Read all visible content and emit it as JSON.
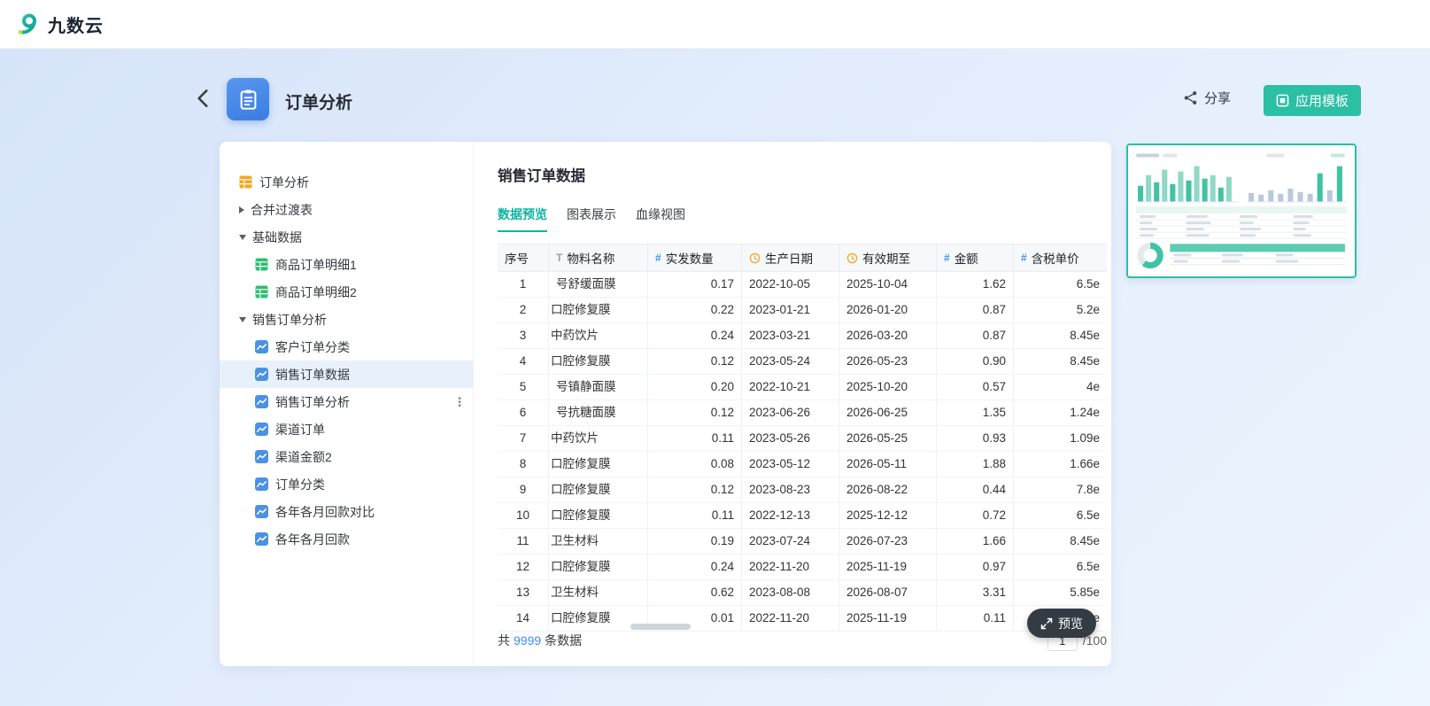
{
  "topbar": {
    "logo_text": "九数云"
  },
  "header": {
    "title": "订单分析",
    "share_label": "分享",
    "apply_template_label": "应用模板"
  },
  "sidebar": {
    "items": [
      {
        "label": "订单分析",
        "icon": "table-orange",
        "level": 0
      },
      {
        "label": "合并过渡表",
        "arrow": "right",
        "level": 0
      },
      {
        "label": "基础数据",
        "arrow": "down",
        "level": 0
      },
      {
        "label": "商品订单明细1",
        "icon": "table-green",
        "level": 1
      },
      {
        "label": "商品订单明细2",
        "icon": "table-green",
        "level": 1
      },
      {
        "label": "销售订单分析",
        "arrow": "down",
        "level": 0
      },
      {
        "label": "客户订单分类",
        "icon": "chart-blue",
        "level": 1
      },
      {
        "label": "销售订单数据",
        "icon": "chart-blue",
        "level": 1,
        "selected": true
      },
      {
        "label": "销售订单分析",
        "icon": "chart-blue",
        "level": 1,
        "menu": true
      },
      {
        "label": "渠道订单",
        "icon": "chart-blue",
        "level": 1
      },
      {
        "label": "渠道金额2",
        "icon": "chart-blue",
        "level": 1
      },
      {
        "label": "订单分类",
        "icon": "chart-blue",
        "level": 1
      },
      {
        "label": "各年各月回款对比",
        "icon": "chart-blue",
        "level": 1
      },
      {
        "label": "各年各月回款",
        "icon": "chart-blue",
        "level": 1
      }
    ]
  },
  "content": {
    "title": "销售订单数据",
    "tabs": [
      {
        "key": "data-preview",
        "label": "数据预览",
        "active": true
      },
      {
        "key": "chart-display",
        "label": "图表展示",
        "active": false
      },
      {
        "key": "lineage-view",
        "label": "血缘视图",
        "active": false
      }
    ],
    "table": {
      "columns": [
        {
          "label": "序号",
          "type": "index"
        },
        {
          "label": "物料名称",
          "type": "text"
        },
        {
          "label": "实发数量",
          "type": "number"
        },
        {
          "label": "生产日期",
          "type": "date"
        },
        {
          "label": "有效期至",
          "type": "date"
        },
        {
          "label": "金额",
          "type": "number"
        },
        {
          "label": "含税单价",
          "type": "number"
        }
      ],
      "rows": [
        {
          "no": 1,
          "name": "号舒缓面膜",
          "clip": false,
          "qty": "0.17",
          "prod": "2022-10-05",
          "exp": "2025-10-04",
          "amount": "1.62",
          "price": "6.5e"
        },
        {
          "no": 2,
          "name": "口腔修复膜",
          "clip": true,
          "qty": "0.22",
          "prod": "2023-01-21",
          "exp": "2026-01-20",
          "amount": "0.87",
          "price": "5.2e"
        },
        {
          "no": 3,
          "name": "中药饮片",
          "clip": true,
          "qty": "0.24",
          "prod": "2023-03-21",
          "exp": "2026-03-20",
          "amount": "0.87",
          "price": "8.45e"
        },
        {
          "no": 4,
          "name": "口腔修复膜",
          "clip": true,
          "qty": "0.12",
          "prod": "2023-05-24",
          "exp": "2026-05-23",
          "amount": "0.90",
          "price": "8.45e"
        },
        {
          "no": 5,
          "name": "号镇静面膜",
          "clip": false,
          "qty": "0.20",
          "prod": "2022-10-21",
          "exp": "2025-10-20",
          "amount": "0.57",
          "price": "4e"
        },
        {
          "no": 6,
          "name": "号抗糖面膜",
          "clip": false,
          "qty": "0.12",
          "prod": "2023-06-26",
          "exp": "2026-06-25",
          "amount": "1.35",
          "price": "1.24e"
        },
        {
          "no": 7,
          "name": "中药饮片",
          "clip": true,
          "qty": "0.11",
          "prod": "2023-05-26",
          "exp": "2026-05-25",
          "amount": "0.93",
          "price": "1.09e"
        },
        {
          "no": 8,
          "name": "口腔修复膜",
          "clip": true,
          "qty": "0.08",
          "prod": "2023-05-12",
          "exp": "2026-05-11",
          "amount": "1.88",
          "price": "1.66e"
        },
        {
          "no": 9,
          "name": "口腔修复膜",
          "clip": true,
          "qty": "0.12",
          "prod": "2023-08-23",
          "exp": "2026-08-22",
          "amount": "0.44",
          "price": "7.8e"
        },
        {
          "no": 10,
          "name": "口腔修复膜",
          "clip": true,
          "qty": "0.11",
          "prod": "2022-12-13",
          "exp": "2025-12-12",
          "amount": "0.72",
          "price": "6.5e"
        },
        {
          "no": 11,
          "name": "卫生材料",
          "clip": true,
          "qty": "0.19",
          "prod": "2023-07-24",
          "exp": "2026-07-23",
          "amount": "1.66",
          "price": "8.45e"
        },
        {
          "no": 12,
          "name": "口腔修复膜",
          "clip": true,
          "qty": "0.24",
          "prod": "2022-11-20",
          "exp": "2025-11-19",
          "amount": "0.97",
          "price": "6.5e"
        },
        {
          "no": 13,
          "name": "卫生材料",
          "clip": true,
          "qty": "0.62",
          "prod": "2023-08-08",
          "exp": "2026-08-07",
          "amount": "3.31",
          "price": "5.85e"
        },
        {
          "no": 14,
          "name": "口腔修复膜",
          "clip": true,
          "qty": "0.01",
          "prod": "2022-11-20",
          "exp": "2025-11-19",
          "amount": "0.11",
          "price": "7.15e"
        }
      ]
    },
    "footer": {
      "total_prefix": "共",
      "total_count": "9999",
      "total_suffix": "条数据",
      "page_value": "1",
      "page_total": "/100"
    }
  },
  "preview": {
    "label": "预览"
  },
  "colors": {
    "accent_teal": "#2BBFA4",
    "tab_active_teal": "#0FB3A2",
    "link_blue": "#3E8BFF",
    "icon_blue": "#4B92E5",
    "icon_orange": "#F5A623",
    "icon_green": "#2EBE71",
    "header_icon_blue": "#3A7CE2",
    "preview_pill_dark": "#343B43"
  }
}
